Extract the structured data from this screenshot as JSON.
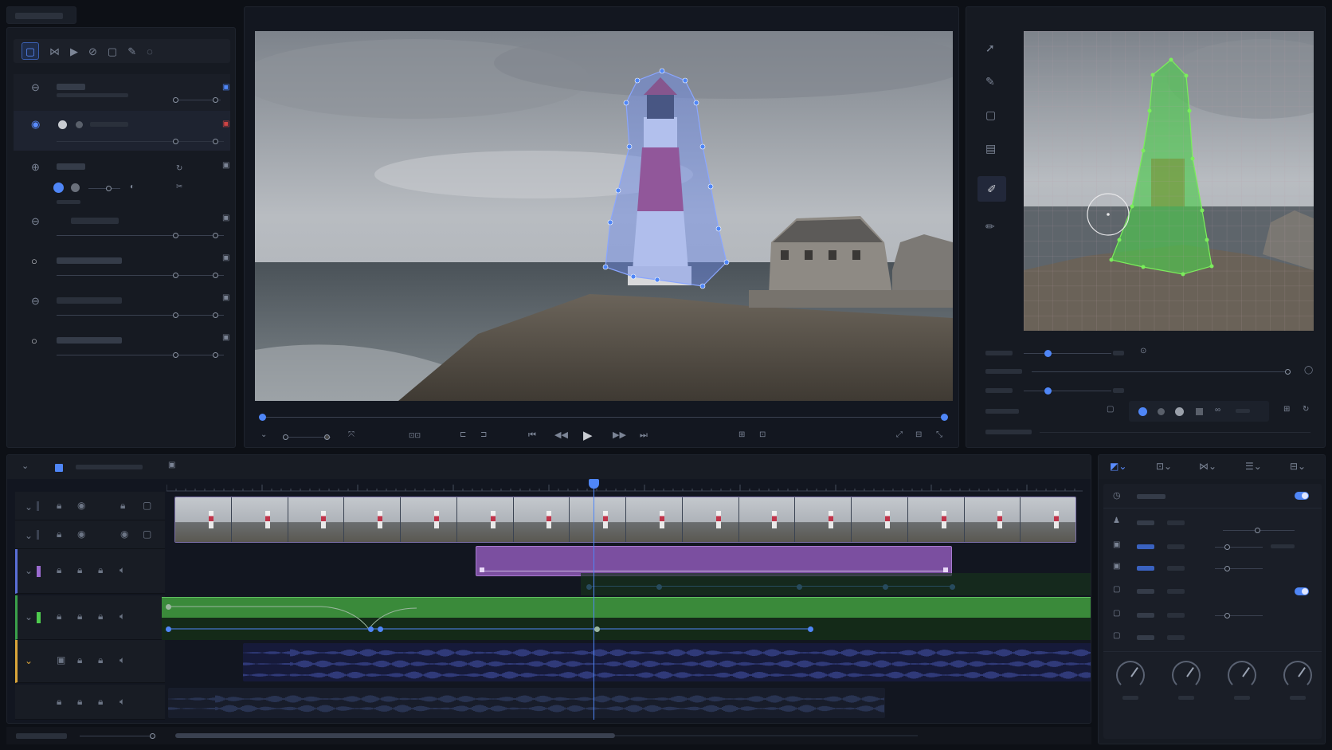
{
  "colors": {
    "accent": "#4f86f7",
    "mask_blue": "#6d8cf0",
    "mask_green": "#4ecb4e",
    "clip_purple": "#7b4fa0",
    "clip_green": "#3a8a3a",
    "audio_blue": "#4a59b8",
    "playhead": "#4f86f7"
  },
  "left_toolbar": {
    "icons": [
      "rectangle-select-icon",
      "mask-icon",
      "play-icon",
      "link-icon",
      "frame-icon",
      "pen-icon",
      "lasso-icon"
    ]
  },
  "layers": [
    {
      "icon": "minus-circle-icon"
    },
    {
      "icon": "radio-selected-icon"
    },
    {
      "icon": "plus-circle-icon"
    },
    {
      "icon": "minus-circle-icon"
    },
    {
      "icon": "circle-icon"
    },
    {
      "icon": "minus-circle-icon"
    },
    {
      "icon": "circle-icon"
    }
  ],
  "viewer": {
    "playback_progress": 0.0,
    "controls": [
      "skip-start-icon",
      "step-back-icon",
      "play-icon",
      "step-forward-icon",
      "skip-end-icon"
    ]
  },
  "side_tools": [
    "pointer-icon",
    "brush-icon",
    "rectangle-icon",
    "mask-layer-icon",
    "paint-icon",
    "eraser-icon"
  ],
  "timeline": {
    "playhead_fraction": 0.46,
    "tracks": [
      {
        "type": "video"
      },
      {
        "type": "video"
      },
      {
        "type": "purple"
      },
      {
        "type": "green"
      },
      {
        "type": "audio"
      },
      {
        "type": "audio2"
      }
    ]
  },
  "inspector": {
    "toolbar_icons": [
      "mask-mode-icon",
      "transform-icon",
      "tracking-icon",
      "settings-icon",
      "export-icon"
    ],
    "toggle_on": true
  }
}
